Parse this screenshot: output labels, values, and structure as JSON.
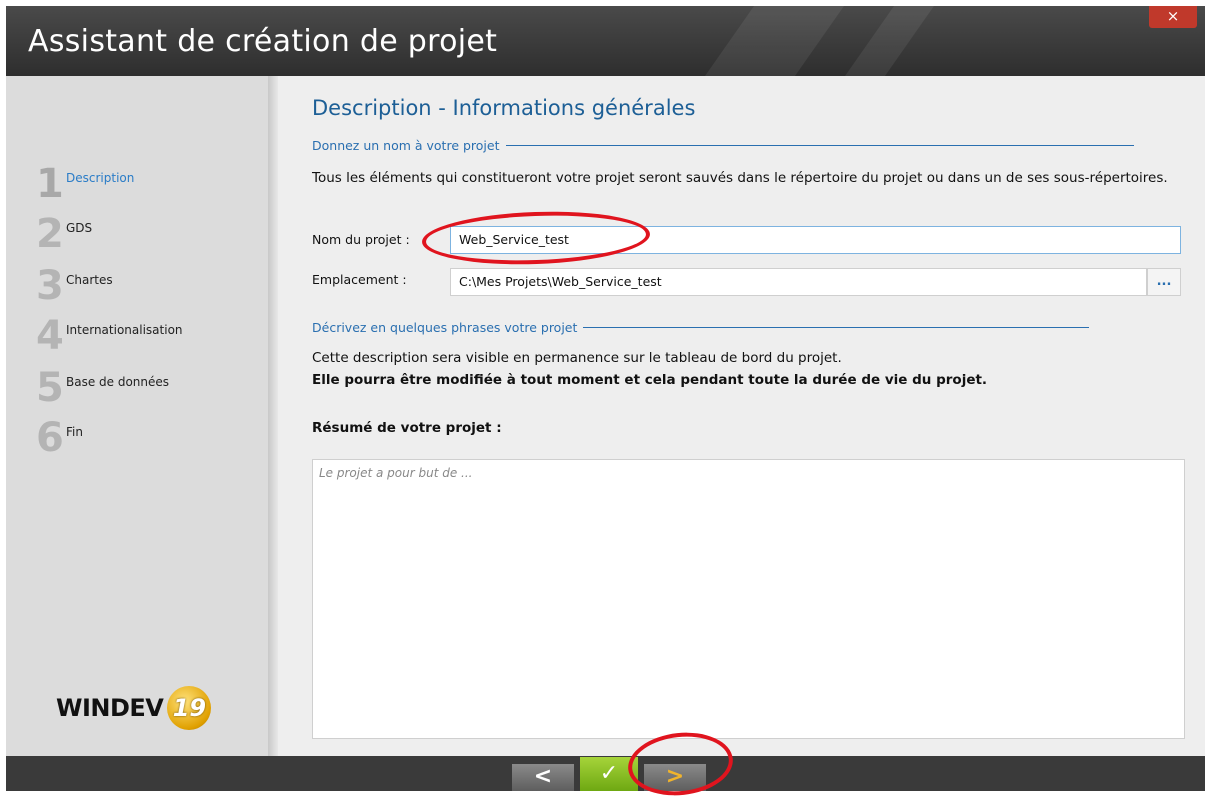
{
  "window": {
    "title": "Assistant de création de projet",
    "close_glyph": "×"
  },
  "sidebar": {
    "steps": [
      {
        "number": "1",
        "label": "Description",
        "active": true
      },
      {
        "number": "2",
        "label": "GDS"
      },
      {
        "number": "3",
        "label": "Chartes"
      },
      {
        "number": "4",
        "label": "Internationalisation"
      },
      {
        "number": "5",
        "label": "Base de données"
      },
      {
        "number": "6",
        "label": "Fin"
      }
    ],
    "logo": {
      "text": "WINDEV",
      "version": "19"
    }
  },
  "main": {
    "page_title": "Description - Informations générales",
    "section_name": {
      "title": "Donnez un nom à votre projet",
      "description": "Tous les éléments qui constitueront votre projet seront sauvés dans le répertoire du projet ou dans un de ses sous-répertoires."
    },
    "project_name": {
      "label": "Nom du projet :",
      "value": "Web_Service_test"
    },
    "location": {
      "label": "Emplacement :",
      "value": "C:\\Mes Projets\\Web_Service_test",
      "browse_label": "..."
    },
    "section_description": {
      "title": "Décrivez en quelques phrases votre projet",
      "line1": "Cette description sera visible en permanence sur le tableau de bord du projet.",
      "line2": "Elle pourra être modifiée à tout moment et cela pendant toute la durée de vie du projet."
    },
    "summary": {
      "label": "Résumé de votre projet :",
      "placeholder": "Le projet a pour but de ..."
    }
  },
  "footer": {
    "back_glyph": "<",
    "validate_glyph": "✓",
    "next_glyph": ">"
  },
  "colors": {
    "accent": "#2a6fb0",
    "title_text": "#1d5f96",
    "validate_green": "#7cb51c",
    "annotation_red": "#e0141e"
  }
}
